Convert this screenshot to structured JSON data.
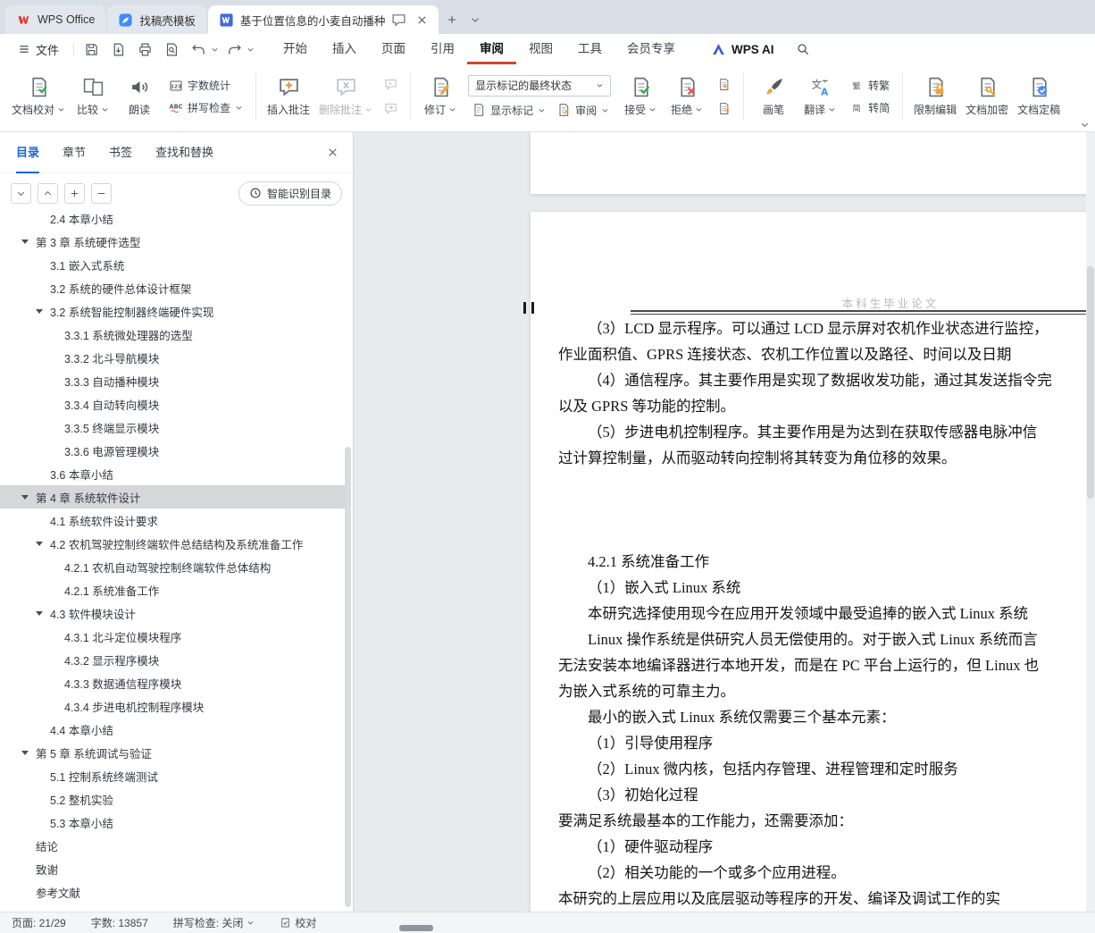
{
  "colors": {
    "accent_red": "#d0452f",
    "accent_blue": "#1a66d4",
    "wps_brand_red": "#e03e30",
    "toc_selected_bg": "#d5d7d9",
    "statusbar_bg": "#f4f5f7",
    "titlebar_bg": "#d9dfe7"
  },
  "titlebar": {
    "tabs": [
      {
        "label": "WPS Office",
        "icon": "wps-logo",
        "type": "home"
      },
      {
        "label": "找稿壳模板",
        "icon": "docer-logo"
      },
      {
        "label": "基于位置信息的小麦自动播种",
        "icon": "word-logo",
        "active": true
      }
    ]
  },
  "menubar": {
    "file_label": "文件",
    "quick_actions": [
      {
        "name": "save-button",
        "icon": "save"
      },
      {
        "name": "output-pdf-button",
        "icon": "export-pdf"
      },
      {
        "name": "print-button",
        "icon": "print"
      },
      {
        "name": "print-preview-button",
        "icon": "preview"
      },
      {
        "name": "undo-button",
        "icon": "undo",
        "dropdown": true
      },
      {
        "name": "redo-button",
        "icon": "redo",
        "dropdown": true
      }
    ],
    "tabs": [
      {
        "label": "开始"
      },
      {
        "label": "插入"
      },
      {
        "label": "页面"
      },
      {
        "label": "引用"
      },
      {
        "label": "审阅",
        "active": true
      },
      {
        "label": "视图"
      },
      {
        "label": "工具"
      },
      {
        "label": "会员专享"
      }
    ],
    "wps_ai_label": "WPS AI"
  },
  "ribbon": {
    "groups": [
      {
        "items": [
          {
            "type": "big",
            "name": "doc-proofing-button",
            "label": "文档校对",
            "icon": "doc-check",
            "dropdown": true
          },
          {
            "type": "big",
            "name": "compare-button",
            "label": "比较",
            "icon": "compare",
            "dropdown": true
          },
          {
            "type": "big",
            "name": "read-aloud-button",
            "label": "朗读",
            "icon": "speaker"
          },
          {
            "type": "stack",
            "items": [
              {
                "name": "word-count-button",
                "label": "字数统计",
                "icon": "count"
              },
              {
                "name": "spell-check-button",
                "label": "拼写检查",
                "icon": "abc",
                "dropdown": true
              }
            ]
          }
        ]
      },
      {
        "items": [
          {
            "type": "big",
            "name": "insert-comment-button",
            "label": "插入批注",
            "icon": "comment-plus"
          },
          {
            "type": "big",
            "name": "delete-comment-button",
            "label": "删除批注",
            "icon": "comment-delete",
            "dropdown": true,
            "disabled": true
          },
          {
            "type": "iconstack",
            "items": [
              {
                "name": "previous-comment-button",
                "icon": "comment-prev",
                "disabled": true
              },
              {
                "name": "next-comment-button",
                "icon": "comment-next",
                "disabled": true
              }
            ]
          }
        ]
      },
      {
        "items": [
          {
            "type": "big",
            "name": "track-changes-button",
            "label": "修订",
            "icon": "revise",
            "dropdown": true
          },
          {
            "type": "combo",
            "name": "markup-state-combobox",
            "value": "显示标记的最终状态",
            "buttons": [
              {
                "name": "show-markup-button",
                "label": "显示标记",
                "icon": "doc",
                "dropdown": true
              },
              {
                "name": "review-button",
                "label": "审阅",
                "icon": "doc-pen",
                "dropdown": true
              }
            ]
          },
          {
            "type": "big",
            "name": "accept-change-button",
            "label": "接受",
            "icon": "accept",
            "dropdown": true
          },
          {
            "type": "big",
            "name": "reject-change-button",
            "label": "拒绝",
            "icon": "reject",
            "dropdown": true
          },
          {
            "type": "iconstack",
            "items": [
              {
                "name": "previous-change-button",
                "icon": "change-prev"
              },
              {
                "name": "next-change-button",
                "icon": "change-next"
              }
            ]
          }
        ]
      },
      {
        "items": [
          {
            "type": "big",
            "name": "ink-brush-button",
            "label": "画笔",
            "icon": "brush"
          },
          {
            "type": "big",
            "name": "translate-button",
            "label": "翻译",
            "icon": "translate",
            "dropdown": true
          },
          {
            "type": "stack",
            "items": [
              {
                "name": "to-traditional-button",
                "label": "转繁",
                "icon": "char-fan"
              },
              {
                "name": "to-simplified-button",
                "label": "转简",
                "icon": "char-jian"
              }
            ]
          }
        ]
      },
      {
        "items": [
          {
            "type": "big",
            "name": "restrict-editing-button",
            "label": "限制编辑",
            "icon": "doc-lock"
          },
          {
            "type": "big",
            "name": "encrypt-document-button",
            "label": "文档加密",
            "icon": "doc-key"
          },
          {
            "type": "big",
            "name": "finalize-document-button",
            "label": "文档定稿",
            "icon": "doc-final"
          }
        ]
      }
    ]
  },
  "sidebar": {
    "tabs": [
      {
        "label": "目录",
        "active": true
      },
      {
        "label": "章节"
      },
      {
        "label": "书签"
      },
      {
        "label": "查找和替换"
      }
    ],
    "controls": [
      {
        "name": "collapse-down-button",
        "icon": "chev"
      },
      {
        "name": "collapse-up-button",
        "icon": "chev-up"
      },
      {
        "name": "expand-all-button",
        "icon": "plus"
      },
      {
        "name": "collapse-all-button",
        "icon": "minus"
      }
    ],
    "smart_toc": {
      "label": "智能识别目录",
      "icon": "magic"
    },
    "toc": [
      {
        "text": "2.4 本章小结",
        "level": 2,
        "clipped": true
      },
      {
        "text": "第 3 章  系统硬件选型",
        "level": 1,
        "expand": true
      },
      {
        "text": "3.1 嵌入式系统",
        "level": 2
      },
      {
        "text": "3.2 系统的硬件总体设计框架",
        "level": 2
      },
      {
        "text": "3.2 系统智能控制器终端硬件实现",
        "level": 2,
        "expand": true
      },
      {
        "text": "3.3.1 系统微处理器的选型",
        "level": 3
      },
      {
        "text": "3.3.2 北斗导航模块",
        "level": 3
      },
      {
        "text": "3.3.3 自动播种模块",
        "level": 3
      },
      {
        "text": "3.3.4 自动转向模块",
        "level": 3
      },
      {
        "text": "3.3.5 终端显示模块",
        "level": 3
      },
      {
        "text": "3.3.6 电源管理模块",
        "level": 3
      },
      {
        "text": "3.6 本章小结",
        "level": 2
      },
      {
        "text": "第 4 章  系统软件设计",
        "level": 1,
        "expand": true,
        "selected": true
      },
      {
        "text": "4.1 系统软件设计要求",
        "level": 2
      },
      {
        "text": "4.2 农机驾驶控制终端软件总结结构及系统准备工作",
        "level": 2,
        "expand": true
      },
      {
        "text": "4.2.1 农机自动驾驶控制终端软件总体结构",
        "level": 3
      },
      {
        "text": "4.2.1 系统准备工作",
        "level": 3
      },
      {
        "text": "4.3 软件模块设计",
        "level": 2,
        "expand": true
      },
      {
        "text": "4.3.1 北斗定位模块程序",
        "level": 3
      },
      {
        "text": "4.3.2 显示程序模块",
        "level": 3
      },
      {
        "text": "4.3.3 数据通信程序模块",
        "level": 3
      },
      {
        "text": "4.3.4 步进电机控制程序模块",
        "level": 3
      },
      {
        "text": "4.4 本章小结",
        "level": 2
      },
      {
        "text": "第 5 章  系统调试与验证",
        "level": 1,
        "expand": true
      },
      {
        "text": "5.1 控制系统终端测试",
        "level": 2
      },
      {
        "text": "5.2 整机实验",
        "level": 2
      },
      {
        "text": "5.3 本章小结",
        "level": 2
      },
      {
        "text": "结论",
        "level": 1
      },
      {
        "text": "致谢",
        "level": 1
      },
      {
        "text": "参考文献",
        "level": 1
      }
    ]
  },
  "document": {
    "header_text": "本科生毕业论文",
    "lines": [
      {
        "t": "（3）LCD 显示程序。可以通过 LCD 显示屏对农机作业状态进行监控，",
        "i": 1
      },
      {
        "t": "作业面积值、GPRS 连接状态、农机工作位置以及路径、时间以及日期",
        "i": 0
      },
      {
        "t": "（4）通信程序。其主要作用是实现了数据收发功能，通过其发送指令完",
        "i": 1
      },
      {
        "t": "以及 GPRS 等功能的控制。",
        "i": 0
      },
      {
        "t": "（5）步进电机控制程序。其主要作用是为达到在获取传感器电脉冲信",
        "i": 1
      },
      {
        "t": "过计算控制量，从而驱动转向控制将其转变为角位移的效果。",
        "i": 0
      },
      {
        "t": "",
        "i": 0
      },
      {
        "t": "",
        "i": 0
      },
      {
        "t": "",
        "i": 0
      },
      {
        "t": "4.2.1 系统准备工作",
        "i": 1
      },
      {
        "t": "（1）嵌入式 Linux 系统",
        "i": 1
      },
      {
        "t": "本研究选择使用现今在应用开发领域中最受追捧的嵌入式 Linux 系统",
        "i": 1
      },
      {
        "t": "Linux 操作系统是供研究人员无偿使用的。对于嵌入式 Linux 系统而言",
        "i": 1
      },
      {
        "t": "无法安装本地编译器进行本地开发，而是在 PC 平台上运行的，但 Linux 也",
        "i": 0
      },
      {
        "t": "为嵌入式系统的可靠主力。",
        "i": 0
      },
      {
        "t": "最小的嵌入式 Linux 系统仅需要三个基本元素：",
        "i": 1
      },
      {
        "t": "（1）引导使用程序",
        "i": 1
      },
      {
        "t": "（2）Linux 微内核，包括内存管理、进程管理和定时服务",
        "i": 1
      },
      {
        "t": "（3）初始化过程",
        "i": 1
      },
      {
        "t": "要满足系统最基本的工作能力，还需要添加：",
        "i": 0
      },
      {
        "t": "（1）硬件驱动程序",
        "i": 1
      },
      {
        "t": "（2）相关功能的一个或多个应用进程。",
        "i": 1
      },
      {
        "t": "本研究的上层应用以及底层驱动等程序的开发、编译及调试工作的实",
        "i": 0
      }
    ]
  },
  "statusbar": {
    "items": [
      {
        "name": "page-indicator",
        "label": "页面: 21/29"
      },
      {
        "name": "word-count-indicator",
        "label": "字数: 13857"
      },
      {
        "name": "spellcheck-toggle",
        "label": "拼写检查: 关闭",
        "dropdown": true
      },
      {
        "name": "proofread-button",
        "label": "校对",
        "icon": "proof"
      }
    ]
  }
}
